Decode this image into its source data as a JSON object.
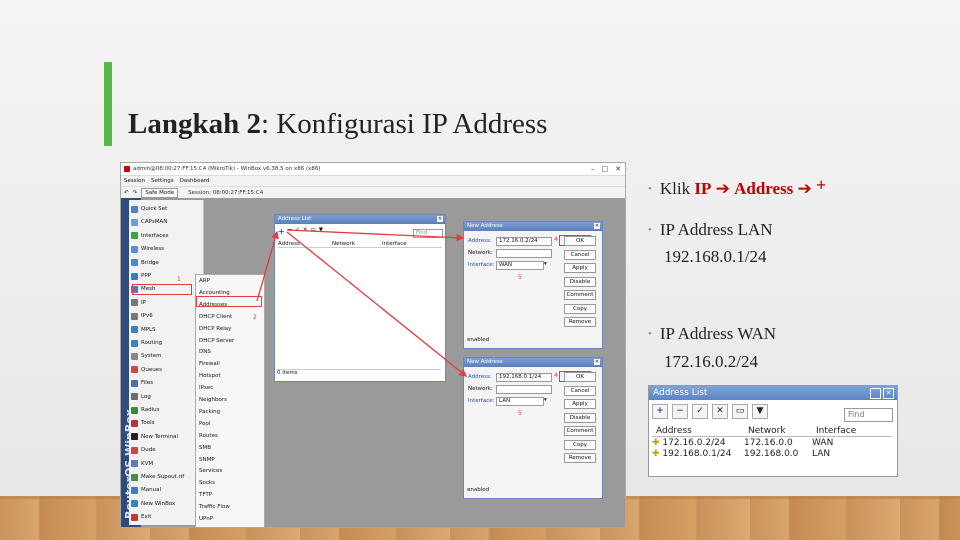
{
  "slide": {
    "title_bold": "Langkah 2",
    "title_rest": ": Konfigurasi IP Address",
    "accent_color": "#58b847"
  },
  "winbox": {
    "titlebar": "admin@08:00:27:FF:15:C4 (MikroTik) - WinBox v6.38.5 on x86 (x86)",
    "menu": [
      "Session",
      "Settings",
      "Dashboard"
    ],
    "toolbar": {
      "safe_mode": "Safe Mode",
      "session": "Session: 08:00:27:FF:15:C4"
    },
    "side_label": "RouterOS WinBox",
    "nav_items": [
      {
        "label": "Quick Set",
        "icon": "quickset-icon",
        "color": "#5a7cc0"
      },
      {
        "label": "CAPsMAN",
        "icon": "capsman-icon",
        "color": "#6aa0d8"
      },
      {
        "label": "Interfaces",
        "icon": "interfaces-icon",
        "color": "#3aa34a"
      },
      {
        "label": "Wireless",
        "icon": "wireless-icon",
        "color": "#5a8fd6"
      },
      {
        "label": "Bridge",
        "icon": "bridge-icon",
        "color": "#4c88c8"
      },
      {
        "label": "PPP",
        "icon": "ppp-icon",
        "color": "#3d7bbd"
      },
      {
        "label": "Mesh",
        "icon": "mesh-icon",
        "color": "#4a7cc7"
      },
      {
        "label": "IP",
        "icon": "ip-icon",
        "color": "#777"
      },
      {
        "label": "IPv6",
        "icon": "ipv6-icon",
        "color": "#777"
      },
      {
        "label": "MPLS",
        "icon": "mpls-icon",
        "color": "#3b7fc4"
      },
      {
        "label": "Routing",
        "icon": "routing-icon",
        "color": "#3b7fc4"
      },
      {
        "label": "System",
        "icon": "system-icon",
        "color": "#888"
      },
      {
        "label": "Queues",
        "icon": "queues-icon",
        "color": "#d04a3a"
      },
      {
        "label": "Files",
        "icon": "files-icon",
        "color": "#4a6fb0"
      },
      {
        "label": "Log",
        "icon": "log-icon",
        "color": "#6c6c6c"
      },
      {
        "label": "Radius",
        "icon": "radius-icon",
        "color": "#3a8a3a"
      },
      {
        "label": "Tools",
        "icon": "tools-icon",
        "color": "#b33"
      },
      {
        "label": "New Terminal",
        "icon": "terminal-icon",
        "color": "#222"
      },
      {
        "label": "Dude",
        "icon": "dude-icon",
        "color": "#c44"
      },
      {
        "label": "KVM",
        "icon": "kvm-icon",
        "color": "#5a7cc0"
      },
      {
        "label": "Make Supout.rif",
        "icon": "supout-icon",
        "color": "#4a8a4a"
      },
      {
        "label": "Manual",
        "icon": "manual-icon",
        "color": "#3b7fc4"
      },
      {
        "label": "New WinBox",
        "icon": "winbox-icon",
        "color": "#3b7fc4"
      },
      {
        "label": "Exit",
        "icon": "exit-icon",
        "color": "#c33"
      }
    ],
    "ip_submenu": [
      "ARP",
      "Accounting",
      "Addresses",
      "DHCP Client",
      "DHCP Relay",
      "DHCP Server",
      "DNS",
      "Firewall",
      "Hotspot",
      "IPsec",
      "Neighbors",
      "Packing",
      "Pool",
      "Routes",
      "SMB",
      "SNMP",
      "Services",
      "Socks",
      "TFTP",
      "Traffic Flow",
      "UPnP"
    ],
    "annotations": {
      "n1": "1",
      "n2": "2",
      "n3": "3",
      "n4a": "4",
      "n4b": "4",
      "n5a": "5",
      "n5b": "5",
      "n6a": "6",
      "n6b": "6"
    },
    "address_list": {
      "title": "Address List",
      "find": "Find",
      "col_address": "Address",
      "col_network": "Network",
      "col_interface": "Interface",
      "status": "0 items"
    },
    "new_address_1": {
      "title": "New Address",
      "address_label": "Address:",
      "address_value": "172.16.0.2/24",
      "network_label": "Network:",
      "interface_label": "Interface:",
      "interface_value": "WAN",
      "buttons": [
        "OK",
        "Cancel",
        "Apply",
        "Disable",
        "Comment",
        "Copy",
        "Remove"
      ],
      "status": "enabled"
    },
    "new_address_2": {
      "title": "New Address",
      "address_label": "Address:",
      "address_value": "192.168.0.1/24",
      "network_label": "Network:",
      "interface_label": "Interface:",
      "interface_value": "LAN",
      "buttons": [
        "OK",
        "Cancel",
        "Apply",
        "Disable",
        "Comment",
        "Copy",
        "Remove"
      ],
      "status": "enabled"
    }
  },
  "bullets": {
    "b1_pre": "Klik ",
    "b1_ip": "IP",
    "b1_arrow1": "➔",
    "b1_address": "Address",
    "b1_arrow2": "➔",
    "b1_plus": "+",
    "b2_line1": "IP Address LAN",
    "b2_line2": "192.168.0.1/24",
    "b3_line1": "IP Address WAN",
    "b3_line2": "172.16.0.2/24",
    "dot": "•"
  },
  "zoom_list": {
    "title": "Address List",
    "find": "Find",
    "headers": [
      "Address",
      "Network",
      "Interface"
    ],
    "rows": [
      {
        "address": "172.16.0.2/24",
        "network": "172.16.0.0",
        "interface": "WAN"
      },
      {
        "address": "192.168.0.1/24",
        "network": "192.168.0.0",
        "interface": "LAN"
      }
    ]
  }
}
